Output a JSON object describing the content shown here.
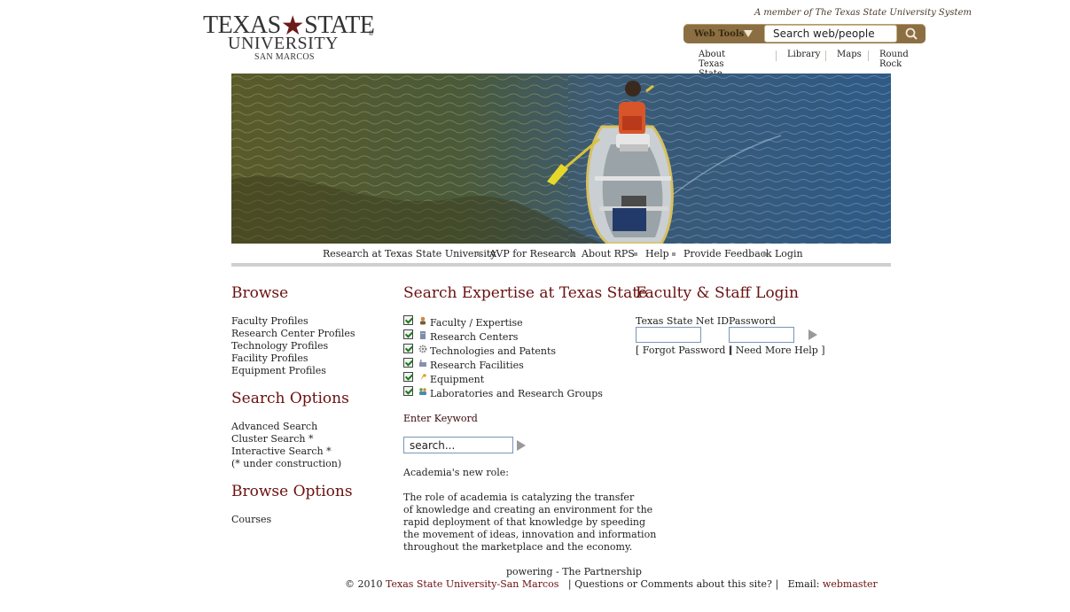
{
  "header": {
    "logo": {
      "line1a": "TEXAS",
      "line1b": "STATE",
      "line2": "UNIVERSITY",
      "line3": "SAN MARCOS",
      "reg": "®"
    },
    "member_text": "A member of The Texas State University System",
    "web_tools_label": "Web Tools",
    "search_value": "Search web/people",
    "top_links": [
      "About Texas State",
      "Library",
      "Maps",
      "Round Rock"
    ]
  },
  "nav": {
    "items": [
      "Research at Texas State University",
      "AVP for Research",
      "About RPS",
      "Help",
      "Provide Feedback",
      "Login"
    ]
  },
  "browse": {
    "title": "Browse",
    "links": [
      "Faculty Profiles",
      "Research Center Profiles",
      "Technology Profiles",
      "Facility Profiles",
      "Equipment Profiles"
    ]
  },
  "search_options": {
    "title": "Search Options",
    "links": [
      "Advanced Search",
      "Cluster Search *",
      "Interactive Search *"
    ],
    "note": "(* under construction)"
  },
  "browse_options": {
    "title": "Browse Options",
    "links": [
      "Courses"
    ]
  },
  "search_expertise": {
    "title": "Search Expertise at Texas State",
    "options": [
      {
        "label": "Faculty / Expertise",
        "checked": true,
        "icon": "person-icon"
      },
      {
        "label": "Research Centers",
        "checked": true,
        "icon": "building-icon"
      },
      {
        "label": "Technologies and Patents",
        "checked": true,
        "icon": "gear-icon"
      },
      {
        "label": "Research Facilities",
        "checked": true,
        "icon": "factory-icon"
      },
      {
        "label": "Equipment",
        "checked": true,
        "icon": "tool-icon"
      },
      {
        "label": "Laboratories and Research Groups",
        "checked": true,
        "icon": "group-icon"
      }
    ],
    "keyword_label": "Enter Keyword",
    "keyword_placeholder": "search...",
    "blurb_title": "Academia's new role:",
    "blurb_lines": [
      "The role of academia is catalyzing the transfer",
      "of knowledge and creating an environment for the",
      "rapid deployment of that knowledge by speeding",
      "the movement of ideas, innovation and information",
      "throughout the marketplace and the economy."
    ]
  },
  "login": {
    "title": "Faculty & Staff Login",
    "netid_label": "Texas State Net ID",
    "password_label": "Password",
    "forgot": "[ Forgot Password ]",
    "need_help": "[ Need More Help ]"
  },
  "footer": {
    "powering": "powering - The Partnership",
    "copyright": "© 2010",
    "university_link": "Texas State University-San Marcos",
    "questions": "| Questions or Comments about this site? |",
    "email_label": "Email:",
    "email_link": "webmaster"
  },
  "colors": {
    "maroon": "#6b1010",
    "gold_bar": "#8b6f43"
  }
}
